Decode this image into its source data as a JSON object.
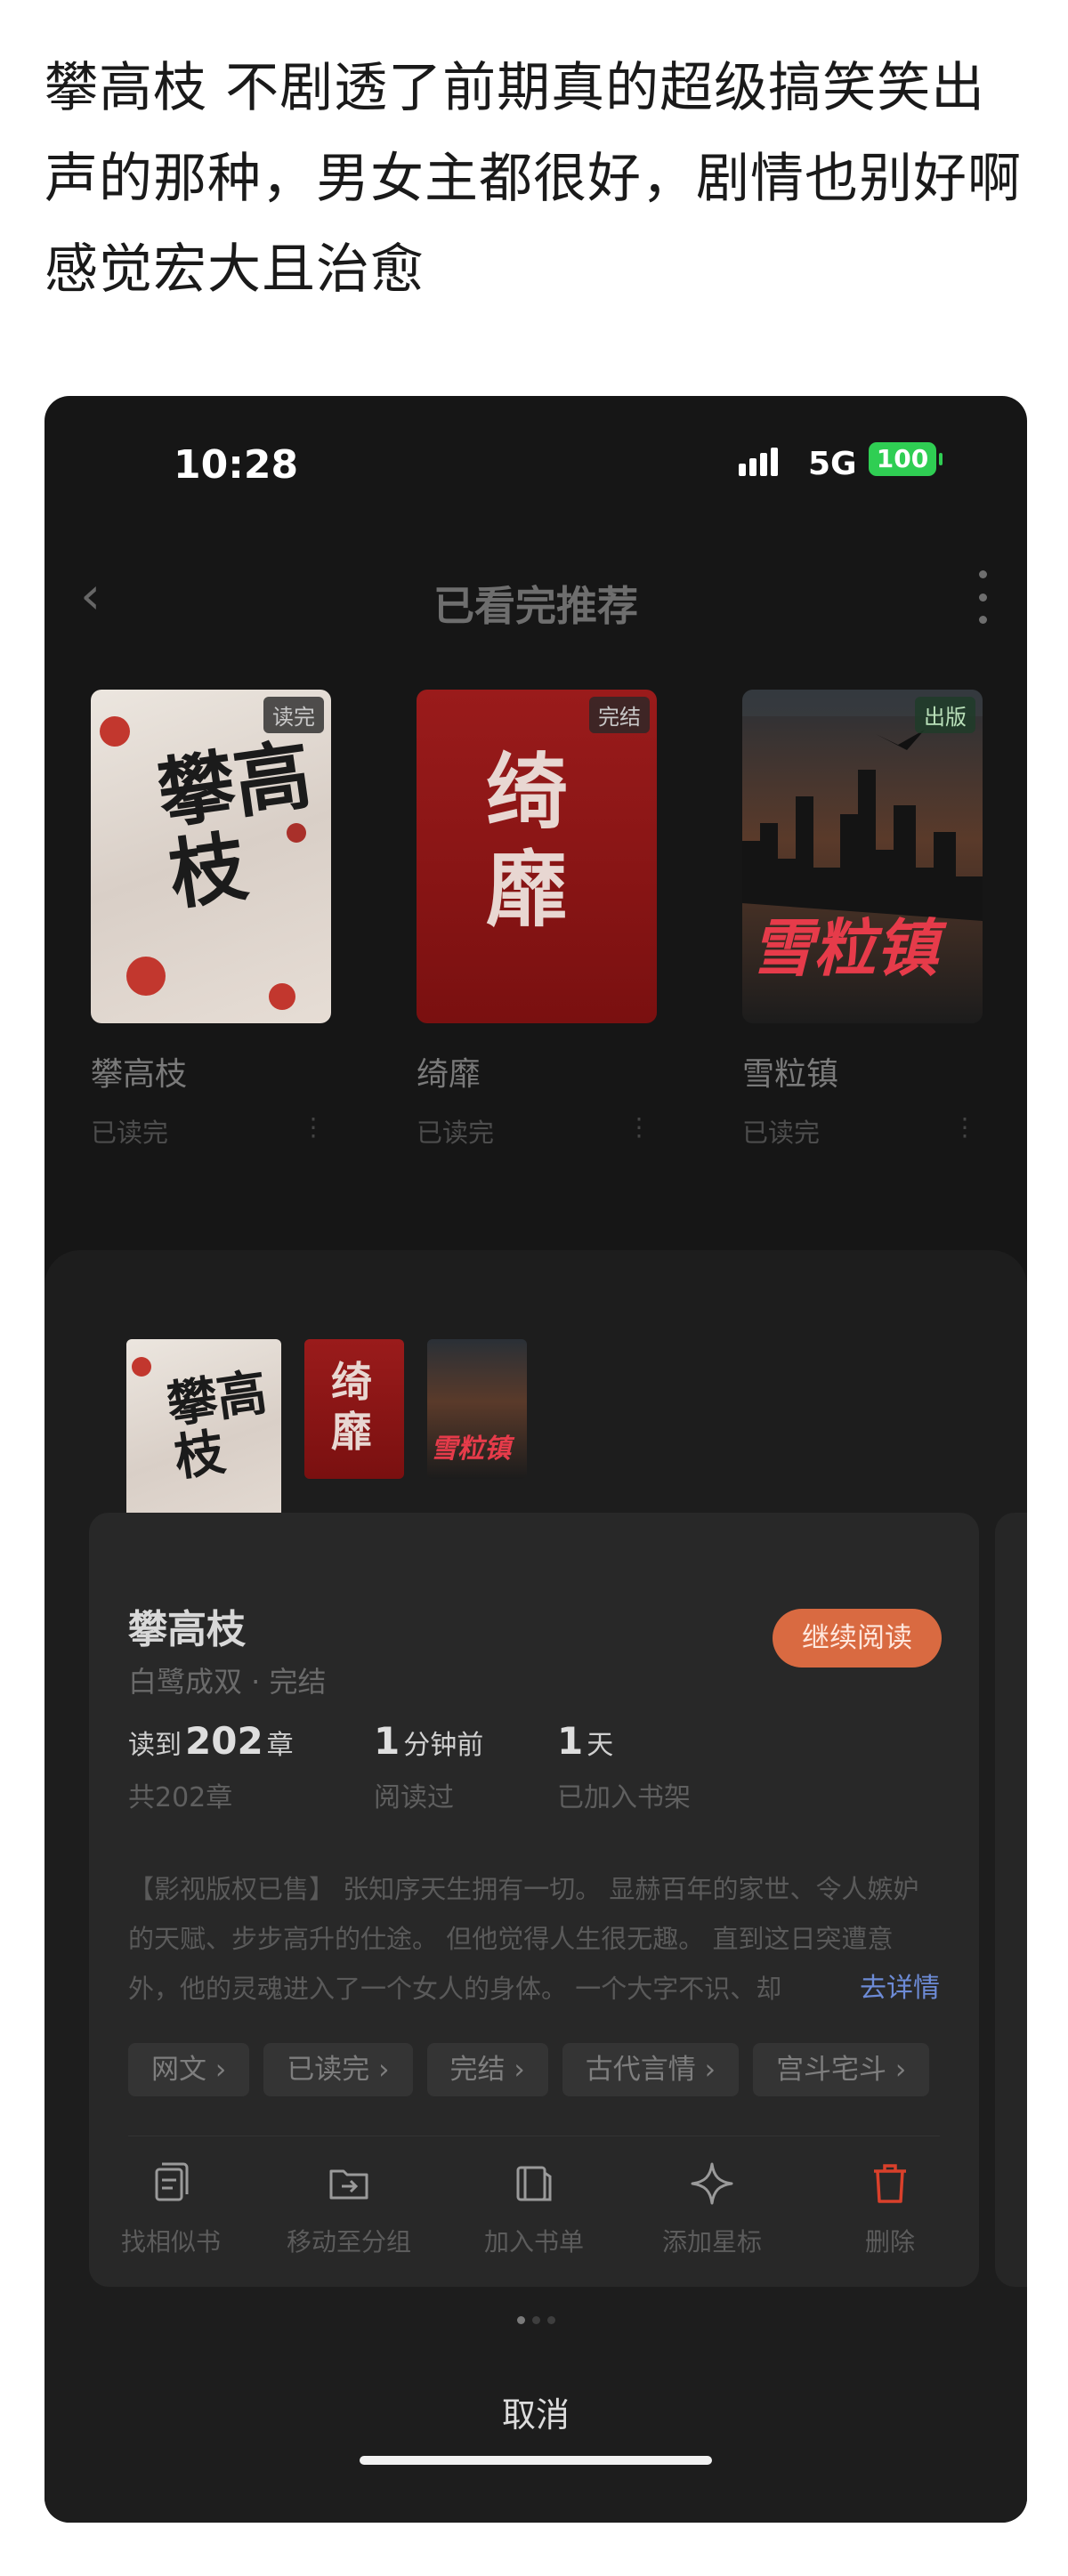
{
  "post": {
    "text": "攀高枝 不剧透了前期真的超级搞笑笑出声的那种，男女主都很好，剧情也别好啊感觉宏大且治愈"
  },
  "status_bar": {
    "time": "10:28",
    "network": "5G",
    "battery": "100",
    "battery_color": "#2fce53"
  },
  "nav": {
    "back_icon": "chevron-left-icon",
    "title": "已看完推荐",
    "more_icon": "vertical-dots-icon"
  },
  "books": [
    {
      "title": "攀高枝",
      "status": "已读完",
      "badge": "读完",
      "cover_text": "攀高枝"
    },
    {
      "title": "绮靡",
      "status": "已读完",
      "badge": "完结",
      "cover_text": "绮靡"
    },
    {
      "title": "雪粒镇",
      "status": "已读完",
      "badge": "出版",
      "cover_text": "雪粒镇"
    }
  ],
  "detail": {
    "title": "攀高枝",
    "author_line": "白鹭成双 · 完结",
    "continue_label": "继续阅读",
    "accent": "#d96a41",
    "stats": [
      {
        "prefix": "读到",
        "value": "202",
        "suffix": "章",
        "label": "共202章"
      },
      {
        "prefix": "",
        "value": "1",
        "suffix": "分钟前",
        "label": "阅读过"
      },
      {
        "prefix": "",
        "value": "1",
        "suffix": "天",
        "label": "已加入书架"
      }
    ],
    "description": "【影视版权已售】 张知序天生拥有一切。 显赫百年的家世、令人嫉妒的天赋、步步高升的仕途。 但他觉得人生很无趣。 直到这日突遭意外，他的灵魂进入了一个女人的身体。 一个大字不识、却",
    "description_more": "去详情",
    "tags": [
      "网文 ›",
      "已读完 ›",
      "完结 ›",
      "古代言情 ›",
      "宫斗宅斗 ›"
    ],
    "actions": [
      {
        "label": "找相似书",
        "icon": "similar-books-icon"
      },
      {
        "label": "移动至分组",
        "icon": "move-to-group-icon"
      },
      {
        "label": "加入书单",
        "icon": "add-to-booklist-icon"
      },
      {
        "label": "添加星标",
        "icon": "star-sparkle-icon"
      },
      {
        "label": "删除",
        "icon": "trash-icon"
      }
    ],
    "delete_color": "#d9402b"
  },
  "sheet": {
    "cancel_label": "取消"
  }
}
